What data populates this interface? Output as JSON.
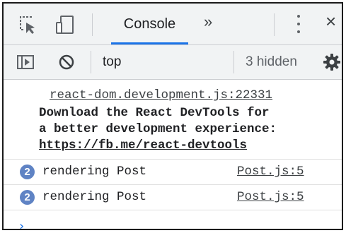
{
  "toolbar": {
    "tab_console": "Console",
    "more_tabs": "»",
    "close": "×"
  },
  "filterbar": {
    "context": "top",
    "hidden": "3 hidden"
  },
  "console": {
    "messages": [
      {
        "source": "react-dom.development.js:22331",
        "lines": [
          "Download the React DevTools for",
          "a better development experience:"
        ],
        "link": "https://fb.me/react-devtools"
      }
    ],
    "rows": [
      {
        "count": "2",
        "text": "rendering Post",
        "source": "Post.js:5"
      },
      {
        "count": "2",
        "text": "rendering Post",
        "source": "Post.js:5"
      }
    ],
    "prompt": "›"
  },
  "colors": {
    "accent": "#1a73e8",
    "badge": "#5f83c4",
    "toolbar_bg": "#f1f3f4"
  }
}
